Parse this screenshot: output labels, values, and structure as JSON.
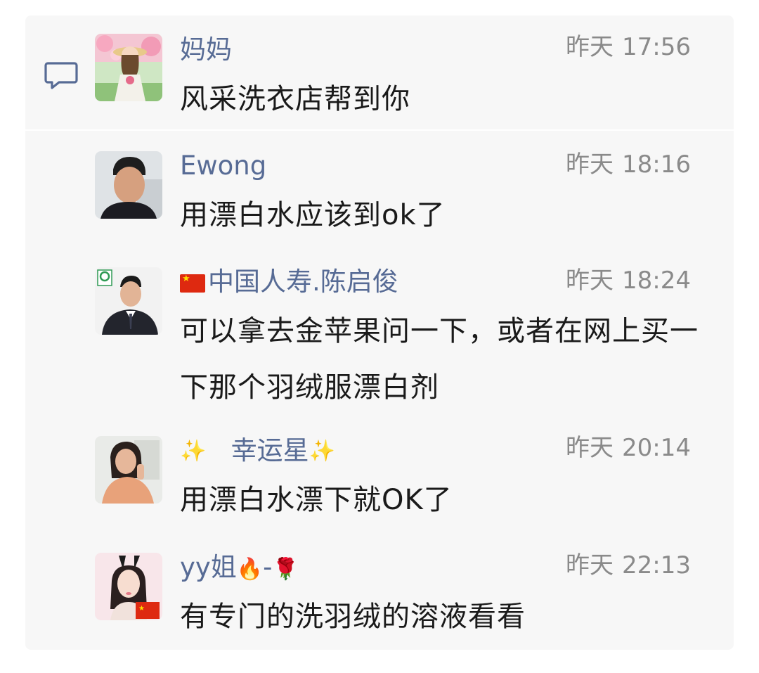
{
  "comments": [
    {
      "name": "妈妈",
      "day": "昨天",
      "time": "17:56",
      "text": "风采洗衣店帮到你",
      "avatar": "girl-with-flowers-avatar"
    },
    {
      "name": "Ewong",
      "day": "昨天",
      "time": "18:16",
      "text": "用漂白水应该到ok了",
      "avatar": "young-man-avatar"
    },
    {
      "name": "中国人寿.陈启俊",
      "day": "昨天",
      "time": "18:24",
      "text": "可以拿去金苹果问一下，或者在网上买一下那个羽绒服漂白剂",
      "avatar": "man-in-suit-avatar",
      "prefix_icon": "china-flag-icon"
    },
    {
      "name": "幸运星",
      "day": "昨天",
      "time": "20:14",
      "text": "用漂白水漂下就OK了",
      "avatar": "woman-selfie-avatar",
      "decor": [
        "✨",
        "✨"
      ]
    },
    {
      "name": "yy姐",
      "name_suffix": "-",
      "day": "昨天",
      "time": "22:13",
      "text": "有专门的洗羽绒的溶液看看",
      "avatar": "cartoon-girl-avatar",
      "icons": [
        "fire-icon",
        "rose-icon"
      ],
      "emoji": {
        "fire": "🔥",
        "rose": "🌹"
      }
    }
  ],
  "colors": {
    "name": "#576b95",
    "time": "#8a8a8a",
    "text": "#1a1a1a",
    "panel": "#f7f7f7"
  }
}
